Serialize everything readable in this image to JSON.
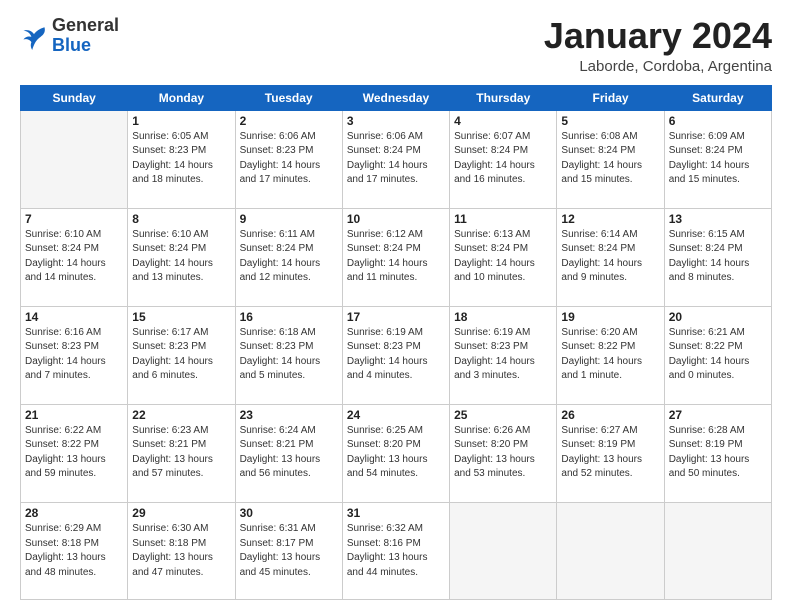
{
  "logo": {
    "general": "General",
    "blue": "Blue"
  },
  "title": "January 2024",
  "subtitle": "Laborde, Cordoba, Argentina",
  "weekdays": [
    "Sunday",
    "Monday",
    "Tuesday",
    "Wednesday",
    "Thursday",
    "Friday",
    "Saturday"
  ],
  "weeks": [
    [
      {
        "day": "",
        "info": ""
      },
      {
        "day": "1",
        "info": "Sunrise: 6:05 AM\nSunset: 8:23 PM\nDaylight: 14 hours\nand 18 minutes."
      },
      {
        "day": "2",
        "info": "Sunrise: 6:06 AM\nSunset: 8:23 PM\nDaylight: 14 hours\nand 17 minutes."
      },
      {
        "day": "3",
        "info": "Sunrise: 6:06 AM\nSunset: 8:24 PM\nDaylight: 14 hours\nand 17 minutes."
      },
      {
        "day": "4",
        "info": "Sunrise: 6:07 AM\nSunset: 8:24 PM\nDaylight: 14 hours\nand 16 minutes."
      },
      {
        "day": "5",
        "info": "Sunrise: 6:08 AM\nSunset: 8:24 PM\nDaylight: 14 hours\nand 15 minutes."
      },
      {
        "day": "6",
        "info": "Sunrise: 6:09 AM\nSunset: 8:24 PM\nDaylight: 14 hours\nand 15 minutes."
      }
    ],
    [
      {
        "day": "7",
        "info": "Sunrise: 6:10 AM\nSunset: 8:24 PM\nDaylight: 14 hours\nand 14 minutes."
      },
      {
        "day": "8",
        "info": "Sunrise: 6:10 AM\nSunset: 8:24 PM\nDaylight: 14 hours\nand 13 minutes."
      },
      {
        "day": "9",
        "info": "Sunrise: 6:11 AM\nSunset: 8:24 PM\nDaylight: 14 hours\nand 12 minutes."
      },
      {
        "day": "10",
        "info": "Sunrise: 6:12 AM\nSunset: 8:24 PM\nDaylight: 14 hours\nand 11 minutes."
      },
      {
        "day": "11",
        "info": "Sunrise: 6:13 AM\nSunset: 8:24 PM\nDaylight: 14 hours\nand 10 minutes."
      },
      {
        "day": "12",
        "info": "Sunrise: 6:14 AM\nSunset: 8:24 PM\nDaylight: 14 hours\nand 9 minutes."
      },
      {
        "day": "13",
        "info": "Sunrise: 6:15 AM\nSunset: 8:24 PM\nDaylight: 14 hours\nand 8 minutes."
      }
    ],
    [
      {
        "day": "14",
        "info": "Sunrise: 6:16 AM\nSunset: 8:23 PM\nDaylight: 14 hours\nand 7 minutes."
      },
      {
        "day": "15",
        "info": "Sunrise: 6:17 AM\nSunset: 8:23 PM\nDaylight: 14 hours\nand 6 minutes."
      },
      {
        "day": "16",
        "info": "Sunrise: 6:18 AM\nSunset: 8:23 PM\nDaylight: 14 hours\nand 5 minutes."
      },
      {
        "day": "17",
        "info": "Sunrise: 6:19 AM\nSunset: 8:23 PM\nDaylight: 14 hours\nand 4 minutes."
      },
      {
        "day": "18",
        "info": "Sunrise: 6:19 AM\nSunset: 8:23 PM\nDaylight: 14 hours\nand 3 minutes."
      },
      {
        "day": "19",
        "info": "Sunrise: 6:20 AM\nSunset: 8:22 PM\nDaylight: 14 hours\nand 1 minute."
      },
      {
        "day": "20",
        "info": "Sunrise: 6:21 AM\nSunset: 8:22 PM\nDaylight: 14 hours\nand 0 minutes."
      }
    ],
    [
      {
        "day": "21",
        "info": "Sunrise: 6:22 AM\nSunset: 8:22 PM\nDaylight: 13 hours\nand 59 minutes."
      },
      {
        "day": "22",
        "info": "Sunrise: 6:23 AM\nSunset: 8:21 PM\nDaylight: 13 hours\nand 57 minutes."
      },
      {
        "day": "23",
        "info": "Sunrise: 6:24 AM\nSunset: 8:21 PM\nDaylight: 13 hours\nand 56 minutes."
      },
      {
        "day": "24",
        "info": "Sunrise: 6:25 AM\nSunset: 8:20 PM\nDaylight: 13 hours\nand 54 minutes."
      },
      {
        "day": "25",
        "info": "Sunrise: 6:26 AM\nSunset: 8:20 PM\nDaylight: 13 hours\nand 53 minutes."
      },
      {
        "day": "26",
        "info": "Sunrise: 6:27 AM\nSunset: 8:19 PM\nDaylight: 13 hours\nand 52 minutes."
      },
      {
        "day": "27",
        "info": "Sunrise: 6:28 AM\nSunset: 8:19 PM\nDaylight: 13 hours\nand 50 minutes."
      }
    ],
    [
      {
        "day": "28",
        "info": "Sunrise: 6:29 AM\nSunset: 8:18 PM\nDaylight: 13 hours\nand 48 minutes."
      },
      {
        "day": "29",
        "info": "Sunrise: 6:30 AM\nSunset: 8:18 PM\nDaylight: 13 hours\nand 47 minutes."
      },
      {
        "day": "30",
        "info": "Sunrise: 6:31 AM\nSunset: 8:17 PM\nDaylight: 13 hours\nand 45 minutes."
      },
      {
        "day": "31",
        "info": "Sunrise: 6:32 AM\nSunset: 8:16 PM\nDaylight: 13 hours\nand 44 minutes."
      },
      {
        "day": "",
        "info": ""
      },
      {
        "day": "",
        "info": ""
      },
      {
        "day": "",
        "info": ""
      }
    ]
  ]
}
